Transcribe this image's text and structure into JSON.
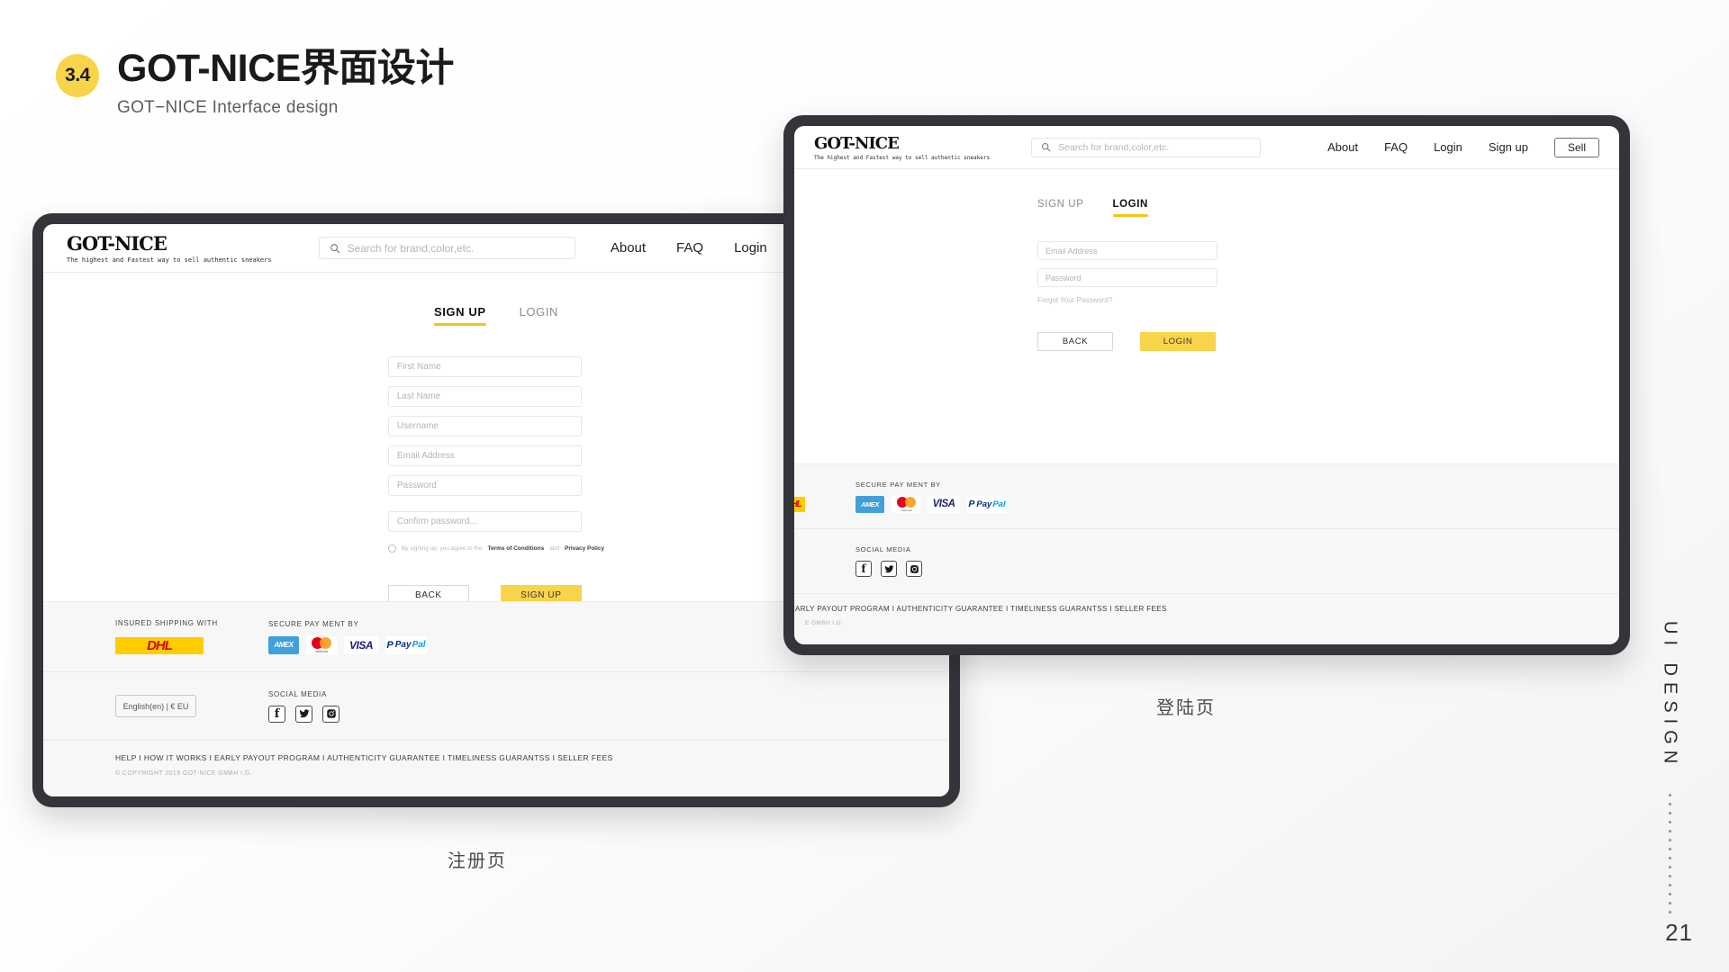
{
  "slide": {
    "number_badge": "3.4",
    "title": "GOT-NICE界面设计",
    "subtitle": "GOT−NICE Interface design",
    "page_number": "21",
    "rail_text": "UI DESIGN",
    "caption_signup": "注册页",
    "caption_login": "登陆页"
  },
  "colors": {
    "accent_yellow": "#F8D44B",
    "tab_underline": "#F5C518",
    "dhl_yellow": "#FFCC00",
    "dhl_red": "#D40511",
    "amex_blue": "#3FA0DA",
    "visa_navy": "#1A1F71",
    "paypal_navy": "#003087",
    "paypal_blue": "#009CDE",
    "mastercard_red": "#EB001B",
    "mastercard_orange": "#F79E1B",
    "device_bezel": "#33353A"
  },
  "site": {
    "brand_name": "GOT-NICE",
    "brand_tagline": "The highest and Fastest way to sell authentic sneakers",
    "search_placeholder": "Search for brand,color,etc.",
    "search_icon": "search-icon",
    "nav": [
      {
        "label": "About"
      },
      {
        "label": "FAQ"
      },
      {
        "label": "Login"
      },
      {
        "label": "Sign up"
      }
    ],
    "sell_label": "Sell"
  },
  "signup_page": {
    "tabs": [
      {
        "label": "SIGN UP",
        "active": true
      },
      {
        "label": "LOGIN",
        "active": false
      }
    ],
    "fields": [
      {
        "placeholder": "First Name"
      },
      {
        "placeholder": "Last Name"
      },
      {
        "placeholder": "Username"
      },
      {
        "placeholder": "Email Address"
      },
      {
        "placeholder": "Password"
      },
      {
        "placeholder": "Confirm password..."
      }
    ],
    "agreement": {
      "prefix": "By signing up, you agree to the",
      "terms": "Terms of Conditions",
      "conjunction": "and",
      "privacy": "Privacy Policy"
    },
    "back_label": "BACK",
    "submit_label": "SIGN UP"
  },
  "login_page": {
    "tabs": [
      {
        "label": "SIGN UP",
        "active": false
      },
      {
        "label": "LOGIN",
        "active": true
      }
    ],
    "fields": [
      {
        "placeholder": "Email Address"
      },
      {
        "placeholder": "Password"
      }
    ],
    "forgot_label": "Forgot Your Password?",
    "back_label": "BACK",
    "submit_label": "LOGIN"
  },
  "footer": {
    "shipping_label": "INSURED SHIPPING WITH",
    "shipping_logo": "DHL",
    "payment_label": "SECURE PAY MENT BY",
    "payment_methods": [
      {
        "name": "AMEX"
      },
      {
        "name": "mastercard"
      },
      {
        "name": "VISA"
      },
      {
        "name": "PayPal"
      }
    ],
    "paypal_parts": {
      "glyph": "P",
      "pay": "Pay",
      "pal": "Pal"
    },
    "language_selector": "English(en)  |  € EU",
    "social_label": "SOCIAL MEDIA",
    "social_icons": [
      {
        "name": "facebook-icon",
        "glyph": "f"
      },
      {
        "name": "twitter-icon",
        "glyph": "twitter"
      },
      {
        "name": "instagram-icon",
        "glyph": "instagram"
      }
    ],
    "links": "HELP  I  HOW IT WORKS  I  EARLY PAYOUT PROGRAM  I  AUTHENTICITY GUARANTEE  I  TIMELINESS GUARANTSS  I  SELLER FEES",
    "links_cropped": "I  EARLY PAYOUT PROGRAM  I  AUTHENTICITY GUARANTEE  I  TIMELINESS GUARANTSS  I  SELLER FEES",
    "copyright": "© COPYRIGHT 2019 GOT-NICE GMBH I.G.",
    "copyright_cropped": "E GMBH I.G."
  }
}
